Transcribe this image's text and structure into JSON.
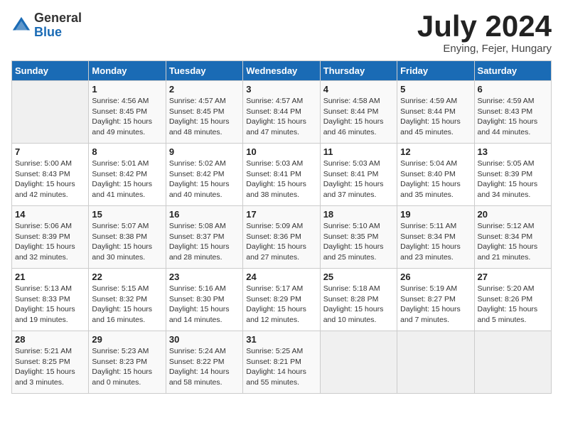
{
  "logo": {
    "general": "General",
    "blue": "Blue"
  },
  "title": "July 2024",
  "location": "Enying, Fejer, Hungary",
  "days_header": [
    "Sunday",
    "Monday",
    "Tuesday",
    "Wednesday",
    "Thursday",
    "Friday",
    "Saturday"
  ],
  "weeks": [
    [
      {
        "day": "",
        "info": ""
      },
      {
        "day": "1",
        "info": "Sunrise: 4:56 AM\nSunset: 8:45 PM\nDaylight: 15 hours\nand 49 minutes."
      },
      {
        "day": "2",
        "info": "Sunrise: 4:57 AM\nSunset: 8:45 PM\nDaylight: 15 hours\nand 48 minutes."
      },
      {
        "day": "3",
        "info": "Sunrise: 4:57 AM\nSunset: 8:44 PM\nDaylight: 15 hours\nand 47 minutes."
      },
      {
        "day": "4",
        "info": "Sunrise: 4:58 AM\nSunset: 8:44 PM\nDaylight: 15 hours\nand 46 minutes."
      },
      {
        "day": "5",
        "info": "Sunrise: 4:59 AM\nSunset: 8:44 PM\nDaylight: 15 hours\nand 45 minutes."
      },
      {
        "day": "6",
        "info": "Sunrise: 4:59 AM\nSunset: 8:43 PM\nDaylight: 15 hours\nand 44 minutes."
      }
    ],
    [
      {
        "day": "7",
        "info": "Sunrise: 5:00 AM\nSunset: 8:43 PM\nDaylight: 15 hours\nand 42 minutes."
      },
      {
        "day": "8",
        "info": "Sunrise: 5:01 AM\nSunset: 8:42 PM\nDaylight: 15 hours\nand 41 minutes."
      },
      {
        "day": "9",
        "info": "Sunrise: 5:02 AM\nSunset: 8:42 PM\nDaylight: 15 hours\nand 40 minutes."
      },
      {
        "day": "10",
        "info": "Sunrise: 5:03 AM\nSunset: 8:41 PM\nDaylight: 15 hours\nand 38 minutes."
      },
      {
        "day": "11",
        "info": "Sunrise: 5:03 AM\nSunset: 8:41 PM\nDaylight: 15 hours\nand 37 minutes."
      },
      {
        "day": "12",
        "info": "Sunrise: 5:04 AM\nSunset: 8:40 PM\nDaylight: 15 hours\nand 35 minutes."
      },
      {
        "day": "13",
        "info": "Sunrise: 5:05 AM\nSunset: 8:39 PM\nDaylight: 15 hours\nand 34 minutes."
      }
    ],
    [
      {
        "day": "14",
        "info": "Sunrise: 5:06 AM\nSunset: 8:39 PM\nDaylight: 15 hours\nand 32 minutes."
      },
      {
        "day": "15",
        "info": "Sunrise: 5:07 AM\nSunset: 8:38 PM\nDaylight: 15 hours\nand 30 minutes."
      },
      {
        "day": "16",
        "info": "Sunrise: 5:08 AM\nSunset: 8:37 PM\nDaylight: 15 hours\nand 28 minutes."
      },
      {
        "day": "17",
        "info": "Sunrise: 5:09 AM\nSunset: 8:36 PM\nDaylight: 15 hours\nand 27 minutes."
      },
      {
        "day": "18",
        "info": "Sunrise: 5:10 AM\nSunset: 8:35 PM\nDaylight: 15 hours\nand 25 minutes."
      },
      {
        "day": "19",
        "info": "Sunrise: 5:11 AM\nSunset: 8:34 PM\nDaylight: 15 hours\nand 23 minutes."
      },
      {
        "day": "20",
        "info": "Sunrise: 5:12 AM\nSunset: 8:34 PM\nDaylight: 15 hours\nand 21 minutes."
      }
    ],
    [
      {
        "day": "21",
        "info": "Sunrise: 5:13 AM\nSunset: 8:33 PM\nDaylight: 15 hours\nand 19 minutes."
      },
      {
        "day": "22",
        "info": "Sunrise: 5:15 AM\nSunset: 8:32 PM\nDaylight: 15 hours\nand 16 minutes."
      },
      {
        "day": "23",
        "info": "Sunrise: 5:16 AM\nSunset: 8:30 PM\nDaylight: 15 hours\nand 14 minutes."
      },
      {
        "day": "24",
        "info": "Sunrise: 5:17 AM\nSunset: 8:29 PM\nDaylight: 15 hours\nand 12 minutes."
      },
      {
        "day": "25",
        "info": "Sunrise: 5:18 AM\nSunset: 8:28 PM\nDaylight: 15 hours\nand 10 minutes."
      },
      {
        "day": "26",
        "info": "Sunrise: 5:19 AM\nSunset: 8:27 PM\nDaylight: 15 hours\nand 7 minutes."
      },
      {
        "day": "27",
        "info": "Sunrise: 5:20 AM\nSunset: 8:26 PM\nDaylight: 15 hours\nand 5 minutes."
      }
    ],
    [
      {
        "day": "28",
        "info": "Sunrise: 5:21 AM\nSunset: 8:25 PM\nDaylight: 15 hours\nand 3 minutes."
      },
      {
        "day": "29",
        "info": "Sunrise: 5:23 AM\nSunset: 8:23 PM\nDaylight: 15 hours\nand 0 minutes."
      },
      {
        "day": "30",
        "info": "Sunrise: 5:24 AM\nSunset: 8:22 PM\nDaylight: 14 hours\nand 58 minutes."
      },
      {
        "day": "31",
        "info": "Sunrise: 5:25 AM\nSunset: 8:21 PM\nDaylight: 14 hours\nand 55 minutes."
      },
      {
        "day": "",
        "info": ""
      },
      {
        "day": "",
        "info": ""
      },
      {
        "day": "",
        "info": ""
      }
    ]
  ]
}
